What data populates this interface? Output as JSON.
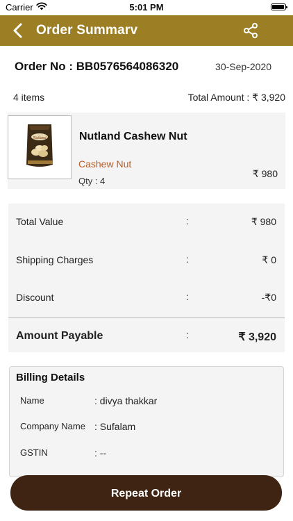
{
  "status_bar": {
    "carrier": "Carrier",
    "time": "5:01 PM"
  },
  "nav": {
    "title": "Order Summarv",
    "back_icon": "chevron-left-icon",
    "share_icon": "share-icon",
    "bar_color": "#9c7f24"
  },
  "order": {
    "order_no": "Order No : BB0576564086320",
    "date": "30-Sep-2020",
    "items_count": "4 items",
    "total_amount": "Total Amount : ₹ 3,920"
  },
  "product": {
    "name": "Nutland Cashew Nut",
    "category": "Cashew Nut",
    "qty": "Qty : 4",
    "price": "₹ 980",
    "image_icon": "product-package-image"
  },
  "summary": {
    "rows": [
      {
        "label": "Total Value",
        "colon": ":",
        "value": "₹ 980"
      },
      {
        "label": "Shipping Charges",
        "colon": ":",
        "value": "₹ 0"
      },
      {
        "label": "Discount",
        "colon": ":",
        "value": "-₹0"
      }
    ],
    "payable": {
      "label": "Amount Payable",
      "colon": ":",
      "value": "₹ 3,920"
    }
  },
  "billing": {
    "title": "Billing Details",
    "rows": [
      {
        "label": "Name",
        "colon": ":",
        "value": "divya thakkar"
      },
      {
        "label": "Company Name",
        "colon": ":",
        "value": "Sufalam"
      },
      {
        "label": "GSTIN",
        "colon": ":",
        "value": "--"
      }
    ]
  },
  "actions": {
    "repeat_order": "Repeat Order",
    "button_color": "#3f2313"
  }
}
